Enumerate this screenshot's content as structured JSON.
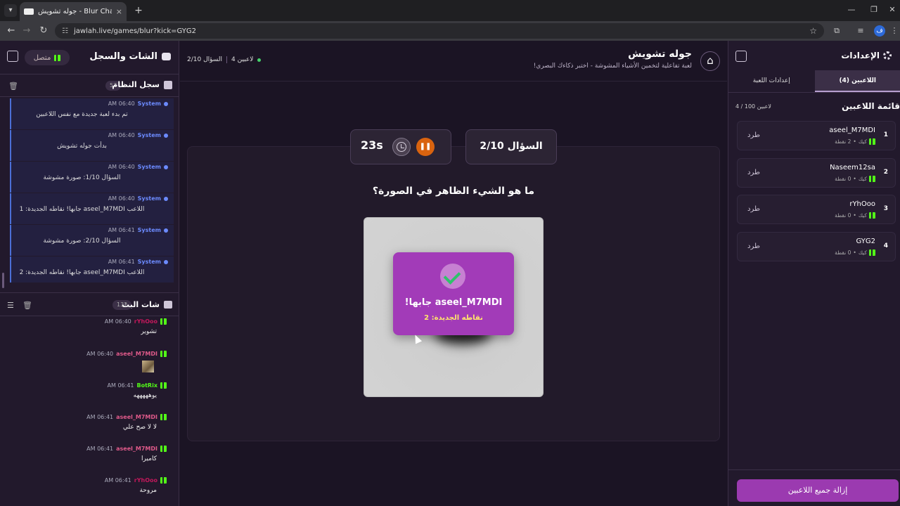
{
  "browser": {
    "tab_title": "جوله تشويش - Blur Challenge |",
    "tab_close": "×",
    "new_tab": "+",
    "url": "jawlah.live/games/blur?kick=GYG2",
    "profile_initial": "ف"
  },
  "left_panel": {
    "title": "الشات والسجل",
    "connection_status": "متصل",
    "system_log": {
      "title": "سجل النظام",
      "count": "57",
      "messages": [
        {
          "sender": "System",
          "time": "06:40 AM",
          "text": "تم بدء لعبة جديدة مع نفس اللاعبين"
        },
        {
          "sender": "System",
          "time": "06:40 AM",
          "text": "بدأت جوله تشويش"
        },
        {
          "sender": "System",
          "time": "06:40 AM",
          "text": "السؤال 1/10: صورة مشوشة"
        },
        {
          "sender": "System",
          "time": "06:40 AM",
          "text": "اللاعب aseel_M7MDI جابها! نقاطه الجديدة: 1"
        },
        {
          "sender": "System",
          "time": "06:41 AM",
          "text": "السؤال 2/10: صورة مشوشة"
        },
        {
          "sender": "System",
          "time": "06:41 AM",
          "text": "اللاعب aseel_M7MDI جابها! نقاطه الجديدة: 2"
        }
      ]
    },
    "live_chat": {
      "title": "شات البث",
      "count": "132",
      "messages": [
        {
          "user": "rYhOoo",
          "time": "06:40 AM",
          "text": "تشوير",
          "color": "#c2185b"
        },
        {
          "user": "aseel_M7MDI",
          "time": "06:40 AM",
          "text": "",
          "color": "#e05a8a",
          "has_image": true
        },
        {
          "user": "BotRix",
          "time": "06:41 AM",
          "text": "يوهههههه",
          "color": "#53fc18"
        },
        {
          "user": "aseel_M7MDI",
          "time": "06:41 AM",
          "text": "لا لا صح علي",
          "color": "#e05a8a"
        },
        {
          "user": "aseel_M7MDI",
          "time": "06:41 AM",
          "text": "كاميرا",
          "color": "#e05a8a"
        },
        {
          "user": "rYhOoo",
          "time": "06:41 AM",
          "text": "مروحة",
          "color": "#c2185b"
        }
      ]
    }
  },
  "header": {
    "title": "جوله تشويش",
    "subtitle": "لعبة تفاعلية لتخمين الأشياء المشوشة - اختبر ذكاءك البصري!",
    "question_progress": "السؤال 2/10",
    "players_count": "4 لاعبين"
  },
  "game": {
    "question_counter": "السؤال 2/10",
    "timer": "23s",
    "question": "ما هو الشيء الظاهر في الصورة؟",
    "correct_text": "aseel_M7MDI جابها!",
    "correct_points": "نقاطه الجديدة: 2"
  },
  "right_panel": {
    "title": "الإعدادات",
    "tabs": [
      "اللاعبين (4)",
      "إعدادات اللعبة"
    ],
    "list_title": "قائمة اللاعبين",
    "list_count": "4 / 100 لاعبين",
    "kick_label": "طرد",
    "platform": "كيك",
    "players": [
      {
        "rank": "1",
        "name": "aseel_M7MDI",
        "points": "2 نقطة"
      },
      {
        "rank": "2",
        "name": "Naseem12sa",
        "points": "0 نقطة"
      },
      {
        "rank": "3",
        "name": "rYhOoo",
        "points": "0 نقطة"
      },
      {
        "rank": "4",
        "name": "GYG2",
        "points": "0 نقطة"
      }
    ],
    "remove_all": "إزالة جميع اللاعبين"
  },
  "colors": {
    "accent_purple": "#a23bb8",
    "timer_orange": "#d9630f",
    "kick_green": "#53fc18",
    "system_blue": "#6c8bff"
  }
}
